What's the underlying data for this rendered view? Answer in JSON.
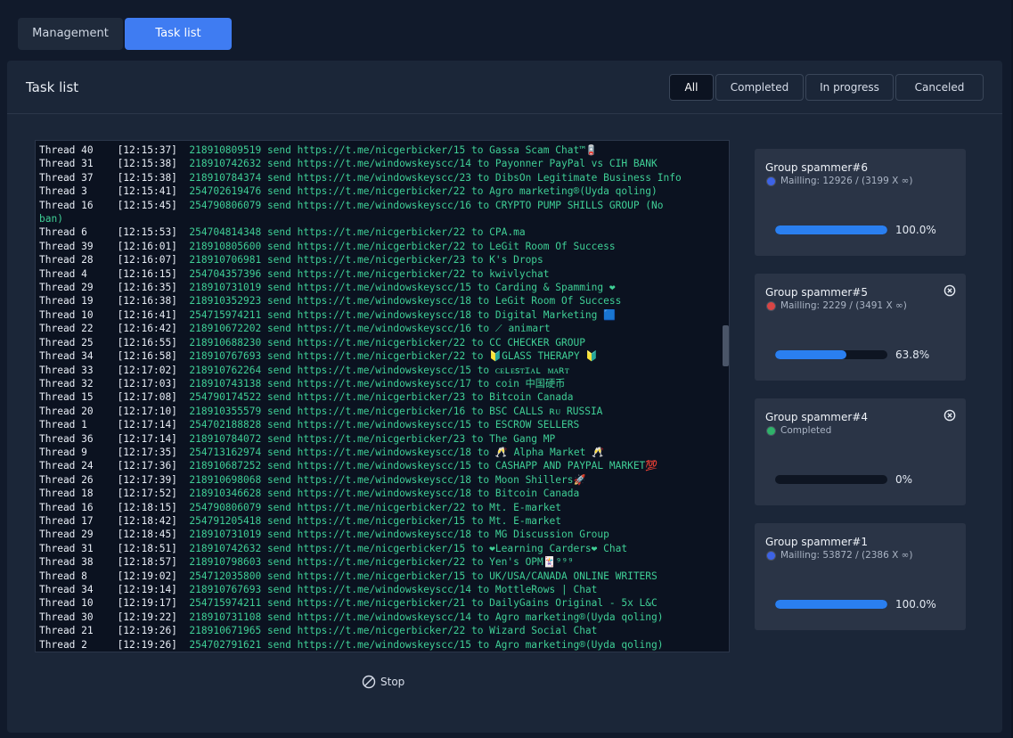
{
  "tabs": [
    {
      "label": "Management",
      "active": false
    },
    {
      "label": "Task list",
      "active": true
    }
  ],
  "panel": {
    "title": "Task list",
    "filters": [
      {
        "label": "All",
        "active": true
      },
      {
        "label": "Completed",
        "active": false
      },
      {
        "label": "In progress",
        "active": false
      },
      {
        "label": "Canceled",
        "active": false
      }
    ]
  },
  "log": [
    {
      "thread": "Thread 40",
      "time": "[12:15:37]",
      "msg": "218910809519 send https://t.me/nicgerbicker/15 to Gassa Scam Chat™🪫"
    },
    {
      "thread": "Thread 31",
      "time": "[12:15:38]",
      "msg": "218910742632 send https://t.me/windowskeyscc/14 to Payonner PayPal vs CIH BANK"
    },
    {
      "thread": "Thread 37",
      "time": "[12:15:38]",
      "msg": "218910784374 send https://t.me/windowskeyscc/23 to DibsOn Legitimate Business Info"
    },
    {
      "thread": "Thread 3",
      "time": "[12:15:41]",
      "msg": "254702619476 send https://t.me/nicgerbicker/22 to Agro marketing®(Uyda qoling)"
    },
    {
      "thread": "Thread 16",
      "time": "[12:15:45]",
      "msg": "254790806079 send https://t.me/windowskeyscc/16 to CRYPTO PUMP SHILLS GROUP (No"
    },
    {
      "thread": "",
      "time": "",
      "msg": "ban)"
    },
    {
      "thread": "Thread 6",
      "time": "[12:15:53]",
      "msg": "254704814348 send https://t.me/nicgerbicker/22 to CPA.ma"
    },
    {
      "thread": "Thread 39",
      "time": "[12:16:01]",
      "msg": "218910805600 send https://t.me/nicgerbicker/22 to LeGit Room Of Success"
    },
    {
      "thread": "Thread 28",
      "time": "[12:16:07]",
      "msg": "218910706981 send https://t.me/nicgerbicker/23 to K's Drops"
    },
    {
      "thread": "Thread 4",
      "time": "[12:16:15]",
      "msg": "254704357396 send https://t.me/nicgerbicker/22 to kwivlychat"
    },
    {
      "thread": "Thread 29",
      "time": "[12:16:35]",
      "msg": "218910731019 send https://t.me/windowskeyscc/15 to Carding & Spamming ❤"
    },
    {
      "thread": "Thread 19",
      "time": "[12:16:38]",
      "msg": "218910352923 send https://t.me/windowskeyscc/18 to LeGit Room Of Success"
    },
    {
      "thread": "Thread 10",
      "time": "[12:16:41]",
      "msg": "254715974211 send https://t.me/windowskeyscc/18 to Digital Marketing 🟦"
    },
    {
      "thread": "Thread 22",
      "time": "[12:16:42]",
      "msg": "218910672202 send https://t.me/windowskeyscc/16 to ⟋ animart"
    },
    {
      "thread": "Thread 25",
      "time": "[12:16:55]",
      "msg": "218910688230 send https://t.me/nicgerbicker/22 to CC CHECKER GROUP"
    },
    {
      "thread": "Thread 34",
      "time": "[12:16:58]",
      "msg": "218910767693 send https://t.me/nicgerbicker/22 to 🔰GLASS THERAPY 🔰"
    },
    {
      "thread": "Thread 33",
      "time": "[12:17:02]",
      "msg": "218910762264 send https://t.me/windowskeyscc/15 to ᴄᴇʟᴇꜱᴛɪᴀʟ ᴍᴀʀᴛ"
    },
    {
      "thread": "Thread 32",
      "time": "[12:17:03]",
      "msg": "218910743138 send https://t.me/windowskeyscc/17 to coin 中国硬币"
    },
    {
      "thread": "Thread 15",
      "time": "[12:17:08]",
      "msg": "254790174522 send https://t.me/nicgerbicker/23 to Bitcoin Canada"
    },
    {
      "thread": "Thread 20",
      "time": "[12:17:10]",
      "msg": "218910355579 send https://t.me/nicgerbicker/16 to BSC CALLS ʀᴜ RUSSIA"
    },
    {
      "thread": "Thread 1",
      "time": "[12:17:14]",
      "msg": "254702188828 send https://t.me/windowskeyscc/15 to ESCROW SELLERS"
    },
    {
      "thread": "Thread 36",
      "time": "[12:17:14]",
      "msg": "218910784072 send https://t.me/nicgerbicker/23 to The Gang MP"
    },
    {
      "thread": "Thread 9",
      "time": "[12:17:35]",
      "msg": "254713162974 send https://t.me/windowskeyscc/18 to 🥂 Alpha Market 🥂"
    },
    {
      "thread": "Thread 24",
      "time": "[12:17:36]",
      "msg": "218910687252 send https://t.me/windowskeyscc/15 to CASHAPP AND PAYPAL MARKET💯"
    },
    {
      "thread": "Thread 26",
      "time": "[12:17:39]",
      "msg": "218910698068 send https://t.me/windowskeyscc/18 to Moon Shillers🚀"
    },
    {
      "thread": "Thread 18",
      "time": "[12:17:52]",
      "msg": "218910346628 send https://t.me/windowskeyscc/18 to Bitcoin Canada"
    },
    {
      "thread": "Thread 16",
      "time": "[12:18:15]",
      "msg": "254790806079 send https://t.me/nicgerbicker/22 to Mt. E-market"
    },
    {
      "thread": "Thread 17",
      "time": "[12:18:42]",
      "msg": "254791205418 send https://t.me/nicgerbicker/15 to Mt. E-market"
    },
    {
      "thread": "Thread 29",
      "time": "[12:18:45]",
      "msg": "218910731019 send https://t.me/windowskeyscc/18 to MG Discussion Group"
    },
    {
      "thread": "Thread 31",
      "time": "[12:18:51]",
      "msg": "218910742632 send https://t.me/nicgerbicker/15 to ❤Learning Carders❤ Chat"
    },
    {
      "thread": "Thread 38",
      "time": "[12:18:57]",
      "msg": "218910798603 send https://t.me/nicgerbicker/22 to Yen's OPM🃏⁹⁹⁹"
    },
    {
      "thread": "Thread 8",
      "time": "[12:19:02]",
      "msg": "254712035800 send https://t.me/nicgerbicker/15 to UK/USA/CANADA ONLINE WRITERS"
    },
    {
      "thread": "Thread 34",
      "time": "[12:19:14]",
      "msg": "218910767693 send https://t.me/windowskeyscc/14 to MottleRows | Chat"
    },
    {
      "thread": "Thread 10",
      "time": "[12:19:17]",
      "msg": "254715974211 send https://t.me/nicgerbicker/21 to DailyGains Original - 5x L&C"
    },
    {
      "thread": "Thread 30",
      "time": "[12:19:22]",
      "msg": "218910731108 send https://t.me/windowskeyscc/14 to Agro marketing®(Uyda qoling)"
    },
    {
      "thread": "Thread 21",
      "time": "[12:19:26]",
      "msg": "218910671965 send https://t.me/nicgerbicker/22 to Wizard Social Chat"
    },
    {
      "thread": "Thread 2",
      "time": "[12:19:26]",
      "msg": "254702791621 send https://t.me/windowskeyscc/15 to Agro marketing®(Uyda qoling)"
    }
  ],
  "stop_label": "Stop",
  "cards": [
    {
      "title": "Group spammer#6",
      "status": "Mailling: 12926 / (3199 X ∞)",
      "status_color": "#3d63e6",
      "progress": 1.0,
      "percent": "100.0%",
      "closable": false
    },
    {
      "title": "Group spammer#5",
      "status": "Mailling: 2229 / (3491 X ∞)",
      "status_color": "#d84545",
      "progress": 0.638,
      "percent": "63.8%",
      "closable": true
    },
    {
      "title": "Group spammer#4",
      "status": "Completed",
      "status_color": "#2fb26a",
      "progress": 0,
      "percent": "0%",
      "closable": true
    },
    {
      "title": "Group spammer#1",
      "status": "Mailling: 53872 / (2386 X ∞)",
      "status_color": "#3d63e6",
      "progress": 1.0,
      "percent": "100.0%",
      "closable": false
    }
  ],
  "colors": {
    "accent": "#3f7cf2",
    "log_text": "#3fcf96",
    "bar_fill": "#2a7ff0"
  }
}
